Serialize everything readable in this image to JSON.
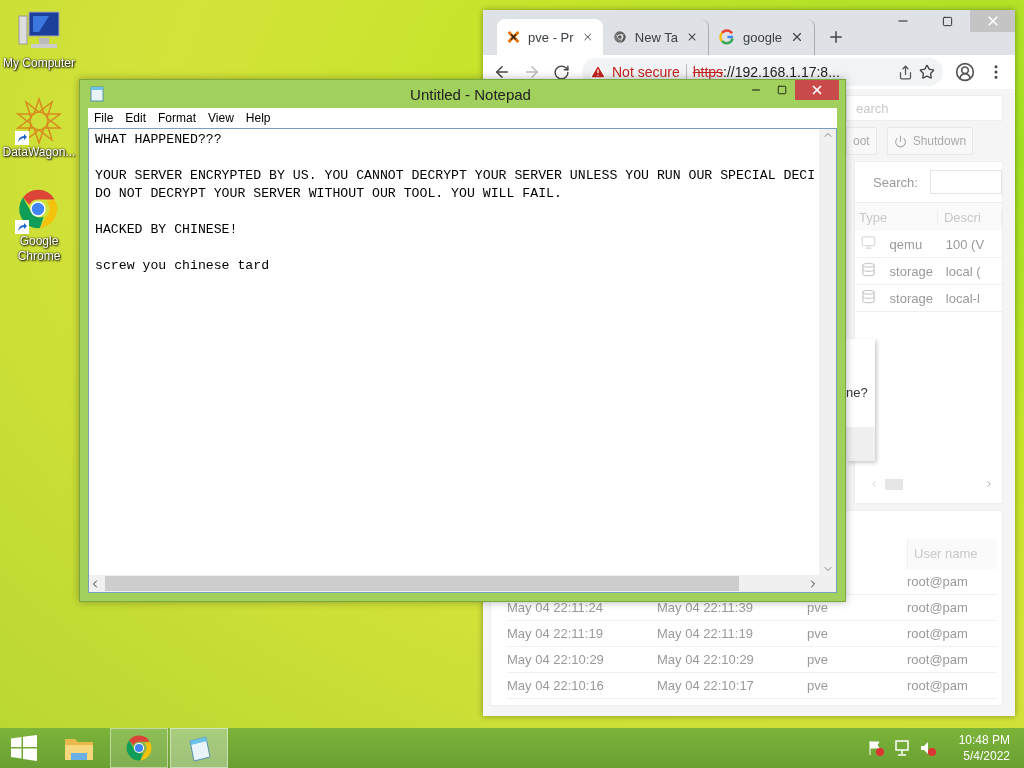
{
  "desktop_icons": [
    {
      "label": "My Computer",
      "kind": "computer",
      "shortcut": false
    },
    {
      "label": "DataWagon...",
      "kind": "star",
      "shortcut": true
    },
    {
      "label": "Google Chrome",
      "kind": "chrome",
      "shortcut": true
    }
  ],
  "browser": {
    "tabs": [
      {
        "title": "pve - Pr",
        "kind": "proxmox",
        "selected": true
      },
      {
        "title": "New Ta",
        "kind": "chrome",
        "selected": false
      },
      {
        "title": "google",
        "kind": "google",
        "selected": false
      }
    ],
    "security": "Not secure",
    "insecure": true,
    "url_scheme": "https",
    "url_rest": "://192.168.1.17:8...",
    "page": {
      "search_field": {
        "placeholder": "earch"
      },
      "buttons": [
        {
          "label": "oot",
          "kind": "plain"
        },
        {
          "label": "Shutdown",
          "kind": "power"
        }
      ],
      "filter_label": "Search:",
      "resource_columns": [
        "Type",
        "Descri"
      ],
      "resources": [
        {
          "type": "qemu",
          "description": "100 (V",
          "kind": "vm"
        },
        {
          "type": "storage",
          "description": "local (",
          "kind": "storage"
        },
        {
          "type": "storage",
          "description": "local-l",
          "kind": "storage"
        }
      ],
      "dialog_text": "ne?",
      "log_columns": [
        "User name"
      ],
      "log_rows": [
        {
          "user": "root@pam"
        },
        {
          "start": "May 04 22:11:24",
          "end": "May 04 22:11:39",
          "node": "pve",
          "user": "root@pam"
        },
        {
          "start": "May 04 22:11:19",
          "end": "May 04 22:11:19",
          "node": "pve",
          "user": "root@pam"
        },
        {
          "start": "May 04 22:10:29",
          "end": "May 04 22:10:29",
          "node": "pve",
          "user": "root@pam"
        },
        {
          "start": "May 04 22:10:16",
          "end": "May 04 22:10:17",
          "node": "pve",
          "user": "root@pam"
        }
      ]
    }
  },
  "notepad": {
    "title": "Untitled - Notepad",
    "menu": [
      "File",
      "Edit",
      "Format",
      "View",
      "Help"
    ],
    "text": "WHAT HAPPENED???\n\nYOUR SERVER ENCRYPTED BY US. YOU CANNOT DECRYPT YOUR SERVER UNLESS YOU RUN OUR SPECIAL DECI\nDO NOT DECRYPT YOUR SERVER WITHOUT OUR TOOL. YOU WILL FAIL.\n\nHACKED BY CHINESE!\n\nscrew you chinese tard"
  },
  "taskbar": {
    "apps": [
      {
        "kind": "explorer",
        "running": false,
        "selected": false
      },
      {
        "kind": "chrome",
        "running": true,
        "selected": false
      },
      {
        "kind": "notepad",
        "running": true,
        "selected": true
      }
    ],
    "time": "10:48 PM",
    "date": "5/4/2022"
  }
}
